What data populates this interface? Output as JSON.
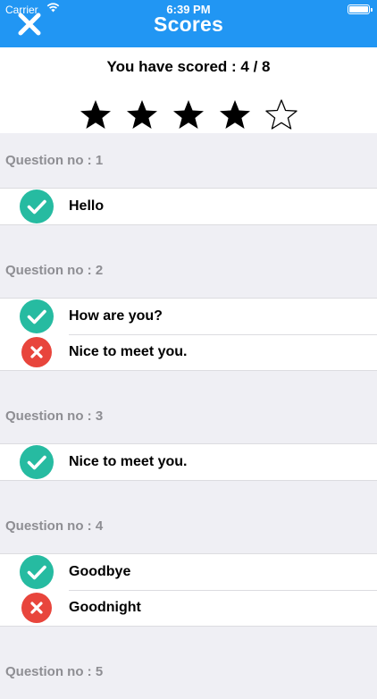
{
  "status_bar": {
    "carrier": "Carrier",
    "time": "6:39 PM"
  },
  "nav": {
    "title": "Scores"
  },
  "score": {
    "text": "You have scored : 4 / 8",
    "stars_filled": 4,
    "stars_total": 5
  },
  "questions": [
    {
      "label": "Question no : 1",
      "answers": [
        {
          "text": "Hello",
          "status": "correct"
        }
      ]
    },
    {
      "label": "Question no : 2",
      "answers": [
        {
          "text": "How are you?",
          "status": "correct"
        },
        {
          "text": "Nice to meet you.",
          "status": "wrong"
        }
      ]
    },
    {
      "label": "Question no : 3",
      "answers": [
        {
          "text": "Nice to meet you.",
          "status": "correct"
        }
      ]
    },
    {
      "label": "Question no : 4",
      "answers": [
        {
          "text": "Goodbye",
          "status": "correct"
        },
        {
          "text": "Goodnight",
          "status": "wrong"
        }
      ]
    },
    {
      "label": "Question no : 5",
      "answers": []
    }
  ],
  "colors": {
    "nav": "#2196f3",
    "correct": "#26bba1",
    "wrong": "#e8453c",
    "section_label": "#8e8e93"
  }
}
